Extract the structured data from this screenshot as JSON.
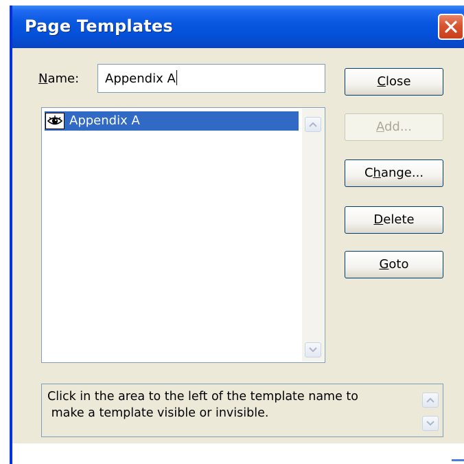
{
  "window": {
    "title": "Page Templates"
  },
  "name_field": {
    "label": "Name:",
    "label_access_key": "N",
    "label_rest": "ame:",
    "value": "Appendix A"
  },
  "templates_list": {
    "items": [
      {
        "label": "Appendix A",
        "visible": true,
        "selected": true
      }
    ]
  },
  "buttons": {
    "close": {
      "label": "Close",
      "key": "C",
      "rest": "lose",
      "enabled": true
    },
    "add": {
      "label": "Add...",
      "key": "A",
      "rest": "dd...",
      "enabled": false
    },
    "change": {
      "label": "Change...",
      "pre": "C",
      "key": "h",
      "rest": "ange...",
      "enabled": true
    },
    "delete": {
      "label": "Delete",
      "key": "D",
      "rest": "elete",
      "enabled": true
    },
    "goto": {
      "label": "Goto",
      "key": "G",
      "rest": "oto",
      "enabled": true
    }
  },
  "status": {
    "line1": "Click in the area to the left of the template name to",
    "line2": " make a template visible or invisible."
  },
  "colors": {
    "titlebar": "#0450d8",
    "selection": "#316ac5",
    "dialog_bg": "#ece9d8",
    "close_button": "#d8532f"
  },
  "icons": {
    "close": "close-x-icon",
    "visibility": "eye-icon",
    "scroll_up": "arrow-up-icon",
    "scroll_down": "arrow-down-icon"
  }
}
